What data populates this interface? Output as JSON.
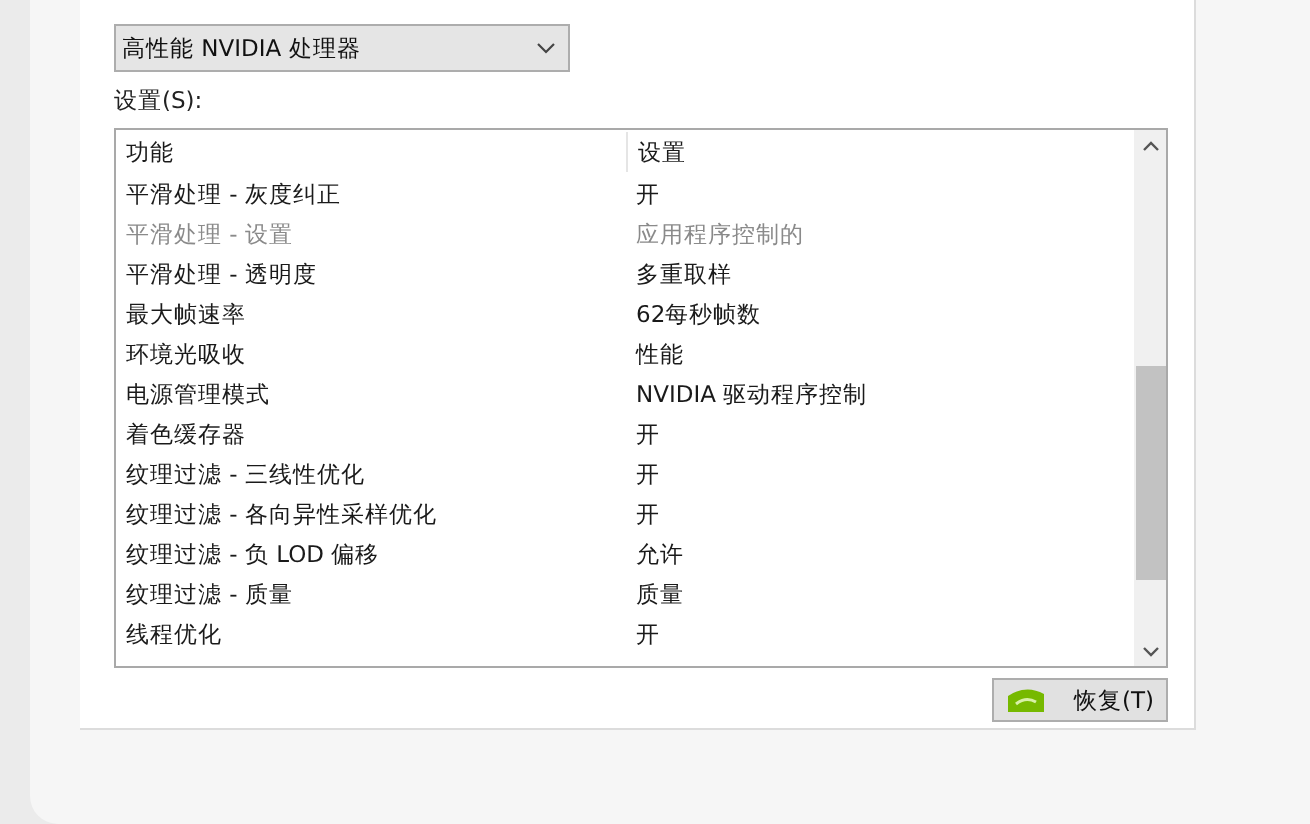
{
  "processor_select": {
    "value": "高性能 NVIDIA 处理器"
  },
  "settings_label": "设置(S):",
  "table": {
    "columns": [
      "功能",
      "设置"
    ],
    "rows": [
      {
        "feature": "平滑处理 - 灰度纠正",
        "setting": "开",
        "disabled": false
      },
      {
        "feature": "平滑处理 - 设置",
        "setting": "应用程序控制的",
        "disabled": true
      },
      {
        "feature": "平滑处理 - 透明度",
        "setting": "多重取样",
        "disabled": false
      },
      {
        "feature": "最大帧速率",
        "setting": "62每秒帧数",
        "disabled": false
      },
      {
        "feature": "环境光吸收",
        "setting": "性能",
        "disabled": false
      },
      {
        "feature": "电源管理模式",
        "setting": "NVIDIA 驱动程序控制",
        "disabled": false
      },
      {
        "feature": "着色缓存器",
        "setting": "开",
        "disabled": false
      },
      {
        "feature": "纹理过滤 - 三线性优化",
        "setting": "开",
        "disabled": false
      },
      {
        "feature": "纹理过滤 - 各向异性采样优化",
        "setting": "开",
        "disabled": false
      },
      {
        "feature": "纹理过滤 - 负 LOD 偏移",
        "setting": "允许",
        "disabled": false
      },
      {
        "feature": "纹理过滤 - 质量",
        "setting": "质量",
        "disabled": false
      },
      {
        "feature": "线程优化",
        "setting": "开",
        "disabled": false
      }
    ]
  },
  "restore_button": {
    "label": "恢复(T)"
  }
}
